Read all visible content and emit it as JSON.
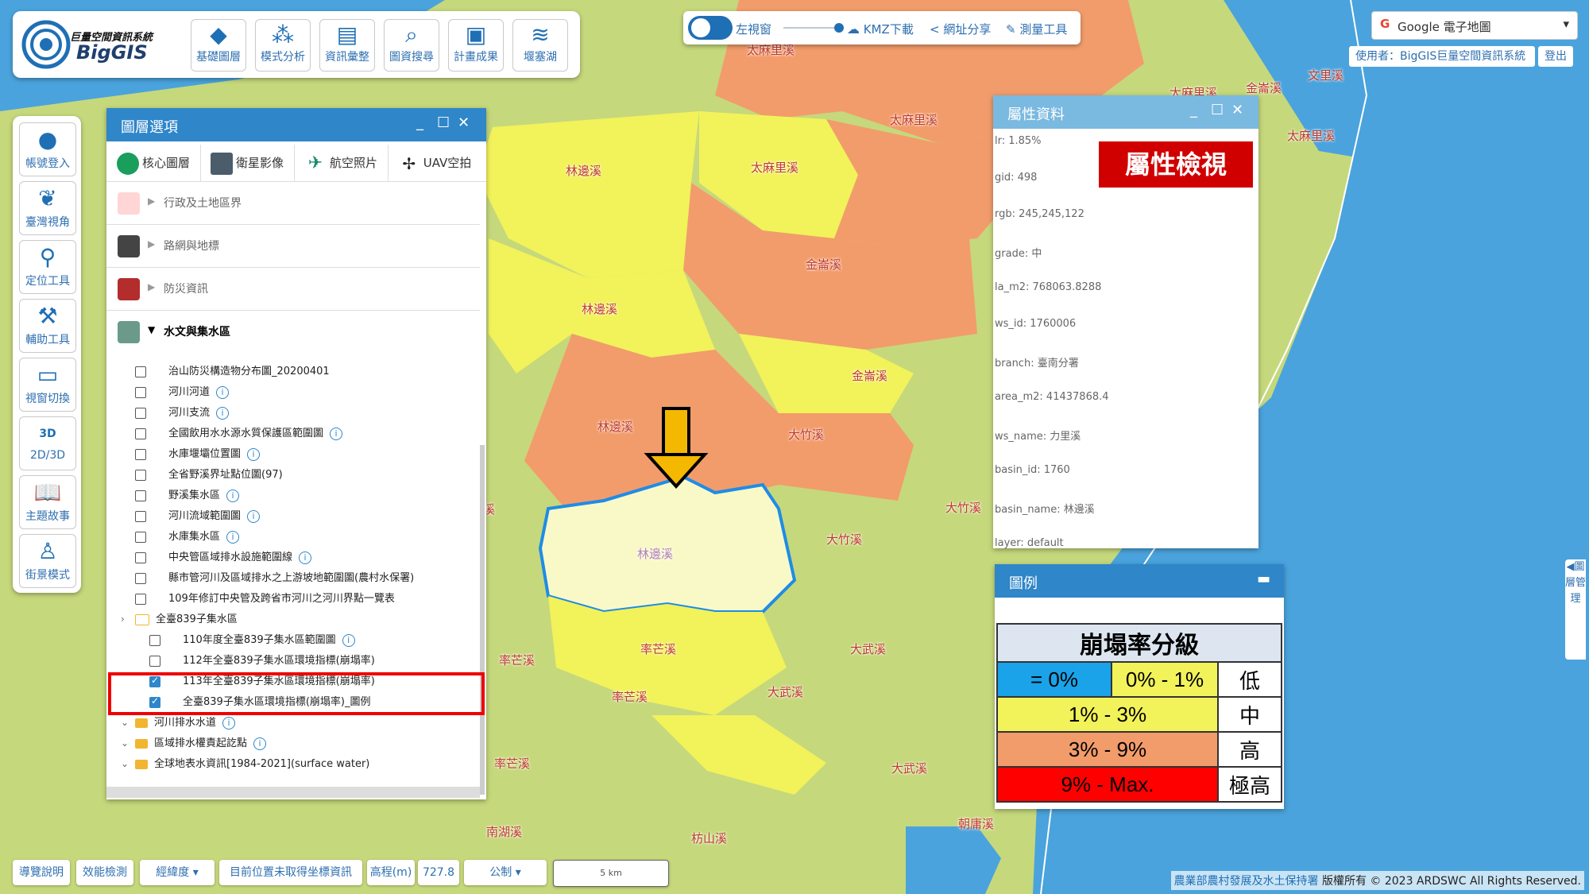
{
  "brand": {
    "title": "巨量空間資訊系統",
    "subtitle": "BigGIS"
  },
  "toolbar": [
    {
      "label": "基礎圖層",
      "icon": "layers-icon"
    },
    {
      "label": "模式分析",
      "icon": "analysis-icon"
    },
    {
      "label": "資訊彙整",
      "icon": "document-icon"
    },
    {
      "label": "圖資搜尋",
      "icon": "search-icon"
    },
    {
      "label": "計畫成果",
      "icon": "image-icon"
    },
    {
      "label": "堰塞湖",
      "icon": "lake-icon"
    }
  ],
  "topcenter": {
    "split": "左視窗",
    "kmz": "KMZ下載",
    "share": "網址分享",
    "measure": "測量工具"
  },
  "basemap": "Google 電子地圖",
  "user": {
    "label": "使用者：BigGIS巨量空間資訊系統",
    "logout": "登出"
  },
  "leftbar": [
    {
      "label": "帳號登入",
      "icon": "user-icon"
    },
    {
      "label": "臺灣視角",
      "icon": "taiwan-icon"
    },
    {
      "label": "定位工具",
      "icon": "pin-icon"
    },
    {
      "label": "輔助工具",
      "icon": "tools-icon"
    },
    {
      "label": "視窗切換",
      "icon": "window-icon"
    },
    {
      "label": "2D/3D",
      "icon": "3d-icon",
      "badge": "3D"
    },
    {
      "label": "主題故事",
      "icon": "book-icon"
    },
    {
      "label": "街景模式",
      "icon": "pegman-icon"
    }
  ],
  "layerpanel": {
    "title": "圖層選項",
    "tabs": [
      "核心圖層",
      "衛星影像",
      "航空照片",
      "UAV空拍"
    ],
    "categories": [
      "行政及土地區界",
      "路網與地標",
      "防災資訊",
      "水文與集水區"
    ],
    "items": [
      {
        "label": "治山防災構造物分布圖_20200401",
        "checked": false,
        "info": false
      },
      {
        "label": "河川河道",
        "checked": false,
        "info": true
      },
      {
        "label": "河川支流",
        "checked": false,
        "info": true
      },
      {
        "label": "全國飲用水水源水質保護區範圍圖",
        "checked": false,
        "info": true
      },
      {
        "label": "水庫堰壩位置圖",
        "checked": false,
        "info": true
      },
      {
        "label": "全省野溪界址點位圖(97)",
        "checked": false,
        "info": false
      },
      {
        "label": "野溪集水區",
        "checked": false,
        "info": true
      },
      {
        "label": "河川流域範圍圖",
        "checked": false,
        "info": true
      },
      {
        "label": "水庫集水區",
        "checked": false,
        "info": true
      },
      {
        "label": "中央管區域排水設施範圍線",
        "checked": false,
        "info": true
      },
      {
        "label": "縣市管河川及區域排水之上游坡地範圍圖(農村水保署)",
        "checked": false,
        "info": false
      },
      {
        "label": "109年修訂中央管及跨省市河川之河川界點一覽表",
        "checked": false,
        "info": false
      }
    ],
    "folder839": "全臺839子集水區",
    "subitems": [
      {
        "label": "110年度全臺839子集水區範圍圖",
        "checked": false,
        "info": true
      },
      {
        "label": "112年全臺839子集水區環境指標(崩塌率)",
        "checked": false,
        "info": false
      },
      {
        "label": "113年全臺839子集水區環境指標(崩塌率)",
        "checked": true,
        "info": false
      },
      {
        "label": "全臺839子集水區環境指標(崩塌率)_圖例",
        "checked": true,
        "info": false
      }
    ],
    "folders": [
      {
        "label": "河川排水水道",
        "info": true
      },
      {
        "label": "區域排水權責起訖點",
        "info": true
      },
      {
        "label": "全球地表水資訊[1984-2021](surface water)",
        "info": false
      }
    ]
  },
  "attr": {
    "title": "屬性資料",
    "badge": "屬性檢視",
    "lines": [
      "lr: 1.85%",
      "gid: 498",
      "rgb: 245,245,122",
      "grade: 中",
      "la_m2: 768063.8288",
      "ws_id: 1760006",
      "branch: 臺南分署",
      "area_m2: 41437868.4",
      "ws_name: 力里溪",
      "basin_id: 1760",
      "basin_name: 林邊溪",
      "layer: default"
    ]
  },
  "legend": {
    "title": "圖例",
    "heading": "崩塌率分級",
    "rows": [
      {
        "range1": "= 0%",
        "range2": "0% - 1%",
        "grade": "低",
        "color1": "#1aa3e8",
        "color2": "#f2f25a"
      },
      {
        "range": "1% - 3%",
        "grade": "中",
        "color": "#f2f25a"
      },
      {
        "range": "3% - 9%",
        "grade": "高",
        "color": "#f29c6b"
      },
      {
        "range": "9% - Max.",
        "grade": "極高",
        "color": "#ff0000"
      }
    ]
  },
  "bottombar": {
    "guide": "導覽說明",
    "perf": "效能檢測",
    "coord": "經緯度",
    "position": "目前位置未取得坐標資訊",
    "elev_label": "高程(m)",
    "elev_value": "727.8",
    "unit": "公制",
    "scale": "5 km"
  },
  "copyright": {
    "org": "農業部農村發展及水土保持署",
    "text": "版權所有 © 2023 ARDSWC All Rights Reserved."
  },
  "sidetab": "◀圖層管理",
  "maplabels": [
    {
      "t": "太麻里溪"
    },
    {
      "t": "太麻里溪"
    },
    {
      "t": "太麻里溪"
    },
    {
      "t": "太麻里溪"
    },
    {
      "t": "太麻里溪"
    },
    {
      "t": "文里溪"
    },
    {
      "t": "林邊溪"
    },
    {
      "t": "林邊溪"
    },
    {
      "t": "林邊溪"
    },
    {
      "t": "林邊溪"
    },
    {
      "t": "金崙溪"
    },
    {
      "t": "金崙溪"
    },
    {
      "t": "大竹溪"
    },
    {
      "t": "大竹溪"
    },
    {
      "t": "大竹溪"
    },
    {
      "t": "率芒溪"
    },
    {
      "t": "率芒溪"
    },
    {
      "t": "率芒溪"
    },
    {
      "t": "率芒溪"
    },
    {
      "t": "大武溪"
    },
    {
      "t": "大武溪"
    },
    {
      "t": "大武溪"
    },
    {
      "t": "南湖溪"
    },
    {
      "t": "枋山溪"
    },
    {
      "t": "朝庸溪"
    },
    {
      "t": "金崙溪"
    },
    {
      "t": "溪"
    }
  ]
}
